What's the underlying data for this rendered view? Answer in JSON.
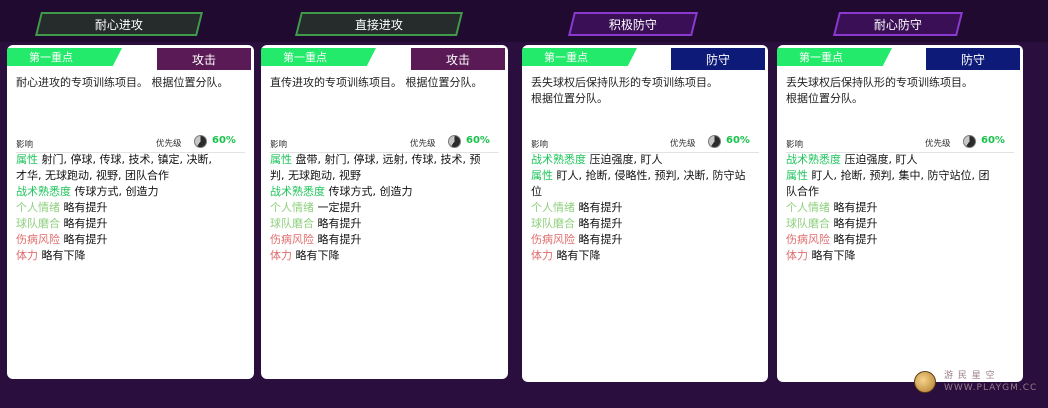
{
  "colors": {
    "background": "#2a0e3d",
    "focus_badge": "#23ea6a",
    "attack_badge": "#5a1a55",
    "defend_badge": "#0e1a78",
    "attr_key": "#1fc55c",
    "soft_key": "#8fd07e",
    "risk_key": "#e06c6c",
    "priority_value": "#19c24b"
  },
  "cards": [
    {
      "tab_title": "耐心进攻",
      "focus_label": "第一重点",
      "type_label": "攻击",
      "type": "attack",
      "description": "耐心进攻的专项训练项目。 根据位置分队。",
      "impact_label": "影响",
      "priority_label": "优先级",
      "priority_value": "60%",
      "priority_fraction": 0.6,
      "stats": [
        {
          "key": "属性",
          "value": "射门, 停球, 传球, 技术, 镇定, 决断,",
          "cls": "k-attr"
        },
        {
          "key": "",
          "value": "才华, 无球跑动, 视野, 团队合作",
          "cls": ""
        },
        {
          "key": "战术熟悉度",
          "value": "传球方式, 创造力",
          "cls": "k-tac"
        },
        {
          "key": "个人情绪",
          "value": "略有提升",
          "cls": "k-mood"
        },
        {
          "key": "球队磨合",
          "value": "略有提升",
          "cls": "k-cohe"
        },
        {
          "key": "伤病风险",
          "value": "略有提升",
          "cls": "k-inj"
        },
        {
          "key": "体力",
          "value": "略有下降",
          "cls": "k-stam"
        }
      ]
    },
    {
      "tab_title": "直接进攻",
      "focus_label": "第一重点",
      "type_label": "攻击",
      "type": "attack",
      "description": "直传进攻的专项训练项目。 根据位置分队。",
      "impact_label": "影响",
      "priority_label": "优先级",
      "priority_value": "60%",
      "priority_fraction": 0.6,
      "stats": [
        {
          "key": "属性",
          "value": "盘带, 射门, 停球, 远射, 传球, 技术, 预",
          "cls": "k-attr"
        },
        {
          "key": "",
          "value": "判, 无球跑动, 视野",
          "cls": ""
        },
        {
          "key": "战术熟悉度",
          "value": "传球方式, 创造力",
          "cls": "k-tac"
        },
        {
          "key": "个人情绪",
          "value": "一定提升",
          "cls": "k-mood"
        },
        {
          "key": "球队磨合",
          "value": "略有提升",
          "cls": "k-cohe"
        },
        {
          "key": "伤病风险",
          "value": "略有提升",
          "cls": "k-inj"
        },
        {
          "key": "体力",
          "value": "略有下降",
          "cls": "k-stam"
        }
      ]
    },
    {
      "tab_title": "积极防守",
      "focus_label": "第一重点",
      "type_label": "防守",
      "type": "defend",
      "description": "丢失球权后保持队形的专项训练项目。\n根据位置分队。",
      "impact_label": "影响",
      "priority_label": "优先级",
      "priority_value": "60%",
      "priority_fraction": 0.6,
      "stats": [
        {
          "key": "战术熟悉度",
          "value": "压迫强度, 盯人",
          "cls": "k-tac"
        },
        {
          "key": "属性",
          "value": "盯人, 抢断, 侵略性, 预判, 决断, 防守站",
          "cls": "k-attr"
        },
        {
          "key": "",
          "value": "位",
          "cls": ""
        },
        {
          "key": "个人情绪",
          "value": "略有提升",
          "cls": "k-mood"
        },
        {
          "key": "球队磨合",
          "value": "略有提升",
          "cls": "k-cohe"
        },
        {
          "key": "伤病风险",
          "value": "略有提升",
          "cls": "k-inj"
        },
        {
          "key": "体力",
          "value": "略有下降",
          "cls": "k-stam"
        }
      ]
    },
    {
      "tab_title": "耐心防守",
      "focus_label": "第一重点",
      "type_label": "防守",
      "type": "defend",
      "description": "丢失球权后保持队形的专项训练项目。\n根据位置分队。",
      "impact_label": "影响",
      "priority_label": "优先级",
      "priority_value": "60%",
      "priority_fraction": 0.6,
      "stats": [
        {
          "key": "战术熟悉度",
          "value": "压迫强度, 盯人",
          "cls": "k-tac"
        },
        {
          "key": "属性",
          "value": "盯人, 抢断, 预判, 集中, 防守站位, 团",
          "cls": "k-attr"
        },
        {
          "key": "",
          "value": "队合作",
          "cls": ""
        },
        {
          "key": "个人情绪",
          "value": "略有提升",
          "cls": "k-mood"
        },
        {
          "key": "球队磨合",
          "value": "略有提升",
          "cls": "k-cohe"
        },
        {
          "key": "伤病风险",
          "value": "略有提升",
          "cls": "k-inj"
        },
        {
          "key": "体力",
          "value": "略有下降",
          "cls": "k-stam"
        }
      ]
    }
  ],
  "watermark": {
    "line1": "游 民 星 空",
    "line2": "WWW.PLAYGM.CC"
  }
}
